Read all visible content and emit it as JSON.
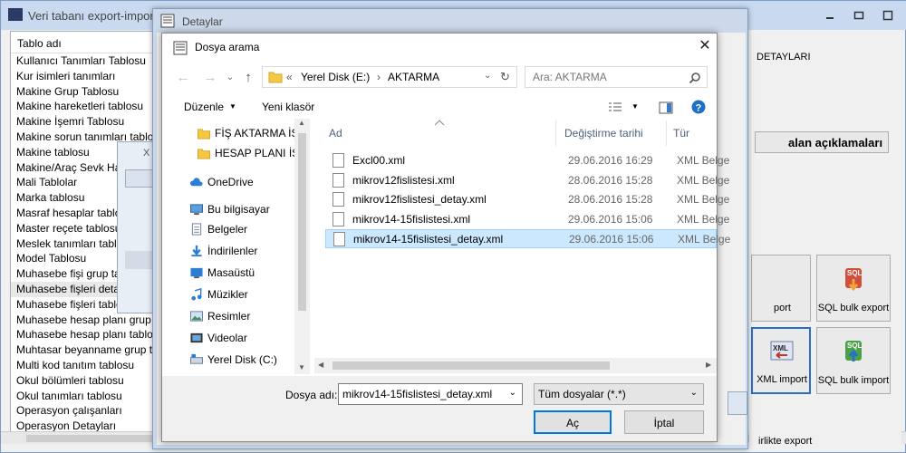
{
  "main": {
    "title": "Veri tabanı export-import-",
    "list_header": "Tablo adı",
    "tables": [
      "Kullanıcı Tanımları Tablosu",
      "Kur isimleri tanımları",
      "Makine Grup Tablosu",
      "Makine hareketleri tablosu",
      "Makine İşemri Tablosu",
      "Makine sorun tanımları tablo",
      "Makine tablosu",
      "Makine/Araç Sevk Har",
      "Mali Tablolar",
      "Marka tablosu",
      "Masraf hesaplar tablo",
      "Master reçete tablosu",
      "Meslek tanımları tablo",
      "Model Tablosu",
      "Muhasebe fişi grup ta",
      "Muhasebe fişleri deta",
      "Muhasebe fişleri tablo",
      "Muhasebe hesap planı grup t",
      "Muhasebe hesap planı tablos",
      "Muhtasar beyanname grup ta",
      "Multi kod tanıtım tablosu",
      "Okul bölümleri tablosu",
      "Okul tanımları tablosu",
      "Operasyon çalışanları",
      "Operasyon Detayları"
    ],
    "selected_index": 15,
    "right_top_label": "DETAYLARI",
    "explanations_button": "alan açıklamaları",
    "tiles": {
      "export_partial": "port",
      "sql_bulk_export": "SQL bulk export",
      "xml_import": "XML import",
      "sql_bulk_import": "SQL bulk import",
      "bottom_partial": "irlikte export"
    },
    "xml_win_title": "X"
  },
  "detaylar": {
    "title": "Detaylar"
  },
  "dialog": {
    "title": "Dosya arama",
    "breadcrumb": {
      "prefix": "«",
      "drive": "Yerel Disk (E:)",
      "folder": "AKTARMA"
    },
    "search_placeholder": "Ara: AKTARMA",
    "toolbar": {
      "organize": "Düzenle",
      "new_folder": "Yeni klasör"
    },
    "nav": [
      {
        "label": "FİŞ AKTARMA İŞ",
        "icon": "folder-icon"
      },
      {
        "label": "HESAP PLANI İŞİ",
        "icon": "folder-icon"
      },
      {
        "label": "OneDrive",
        "icon": "cloud-icon"
      },
      {
        "label": "Bu bilgisayar",
        "icon": "computer-icon"
      },
      {
        "label": "Belgeler",
        "icon": "documents-icon"
      },
      {
        "label": "İndirilenler",
        "icon": "download-icon"
      },
      {
        "label": "Masaüstü",
        "icon": "desktop-icon"
      },
      {
        "label": "Müzikler",
        "icon": "music-icon"
      },
      {
        "label": "Resimler",
        "icon": "pictures-icon"
      },
      {
        "label": "Videolar",
        "icon": "videos-icon"
      },
      {
        "label": "Yerel Disk (C:)",
        "icon": "drive-icon"
      }
    ],
    "columns": {
      "name": "Ad",
      "modified": "Değiştirme tarihi",
      "type": "Tür"
    },
    "files": [
      {
        "name": "Excl00.xml",
        "modified": "29.06.2016 16:29",
        "type": "XML Belge"
      },
      {
        "name": "mikrov12fislistesi.xml",
        "modified": "28.06.2016 15:28",
        "type": "XML Belge"
      },
      {
        "name": "mikrov12fislistesi_detay.xml",
        "modified": "28.06.2016 15:28",
        "type": "XML Belge"
      },
      {
        "name": "mikrov14-15fislistesi.xml",
        "modified": "29.06.2016 15:06",
        "type": "XML Belge"
      },
      {
        "name": "mikrov14-15fislistesi_detay.xml",
        "modified": "29.06.2016 15:06",
        "type": "XML Belge"
      }
    ],
    "selected_file_index": 4,
    "file_name_label": "Dosya adı:",
    "file_name_value": "mikrov14-15fislistesi_detay.xml",
    "file_type": "Tüm dosyalar (*.*)",
    "ok_label": "Aç",
    "cancel_label": "İptal"
  }
}
